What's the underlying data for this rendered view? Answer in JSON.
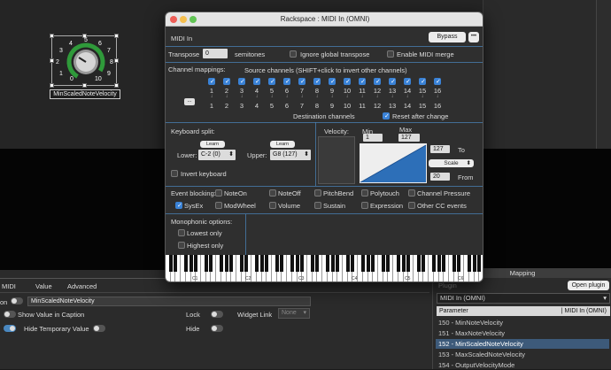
{
  "dialog": {
    "title": "Rackspace : MIDI In (OMNI)",
    "plugin_name": "MIDI In",
    "bypass_label": "Bypass",
    "more_label": "•••",
    "transpose_label": "Transpose",
    "transpose_value": "0",
    "semitones_label": "semitones",
    "ignore_transpose_label": "Ignore global transpose",
    "enable_merge_label": "Enable MIDI merge",
    "channel_mappings_label": "Channel mappings:",
    "source_channels_label": "Source channels (SHIFT+click to invert other channels)",
    "dots_label": "...",
    "channels": [
      "1",
      "2",
      "3",
      "4",
      "5",
      "6",
      "7",
      "8",
      "9",
      "10",
      "11",
      "12",
      "13",
      "14",
      "15",
      "16"
    ],
    "destination_label": "Destination channels",
    "reset_label": "Reset after change",
    "keyboard_split_label": "Keyboard split:",
    "learn_label": "Learn",
    "lower_label": "Lower:",
    "lower_value": "C-2 (0)",
    "upper_label": "Upper:",
    "upper_value": "G8 (127)",
    "invert_label": "Invert keyboard",
    "velocity_label": "Velocity:",
    "min_label": "Min",
    "max_label": "Max",
    "min_value": "1",
    "max_value": "127",
    "to_value": "127",
    "to_label": "To",
    "scale_label": "Scale",
    "from_value": "20",
    "from_label": "From",
    "event_blocking_label": "Event blocking:",
    "events": [
      {
        "label": "NoteOn",
        "checked": false
      },
      {
        "label": "NoteOff",
        "checked": false
      },
      {
        "label": "PitchBend",
        "checked": false
      },
      {
        "label": "Polytouch",
        "checked": false
      },
      {
        "label": "Channel Pressure",
        "checked": false
      },
      {
        "label": "SysEx",
        "checked": true
      },
      {
        "label": "ModWheel",
        "checked": false
      },
      {
        "label": "Volume",
        "checked": false
      },
      {
        "label": "Sustain",
        "checked": false
      },
      {
        "label": "Expression",
        "checked": false
      },
      {
        "label": "Other CC events",
        "checked": false
      }
    ],
    "mono_label": "Monophonic options:",
    "lowest_label": "Lowest only",
    "highest_label": "Highest only",
    "octaves": [
      "C1",
      "C2",
      "C3",
      "C4",
      "C5",
      "C6"
    ]
  },
  "knob": {
    "caption": "MinScaledNoteVelocity",
    "ticks": [
      "0",
      "1",
      "2",
      "3",
      "4",
      "5",
      "6",
      "7",
      "8",
      "9",
      "10"
    ]
  },
  "bottom": {
    "tabs": [
      "MIDI",
      "Value",
      "Advanced"
    ],
    "name_field": "MinScaledNoteVelocity",
    "on_label": "on",
    "show_value_label": "Show Value in Caption",
    "hide_temp_label": "Hide Temporary Value",
    "lock_label": "Lock",
    "widget_link_label": "Widget Link",
    "widget_link_value": "None",
    "hide_label": "Hide"
  },
  "mapping": {
    "title": "Mapping",
    "plugin_label": "Plugin",
    "open_plugin_label": "Open plugin",
    "plugin_value": "MIDI In (OMNI)",
    "param_header": "Parameter",
    "plugin_header": "| MIDI In (OMNI)",
    "params": [
      "150 - MinNoteVelocity",
      "151 - MaxNoteVelocity",
      "152 - MinScaledNoteVelocity",
      "153 - MaxScaledNoteVelocity",
      "154 - OutputVelocityMode"
    ],
    "selected_index": 2
  },
  "colors": {
    "accent": "#3a82d6",
    "knob_green": "#2f9a3a"
  }
}
